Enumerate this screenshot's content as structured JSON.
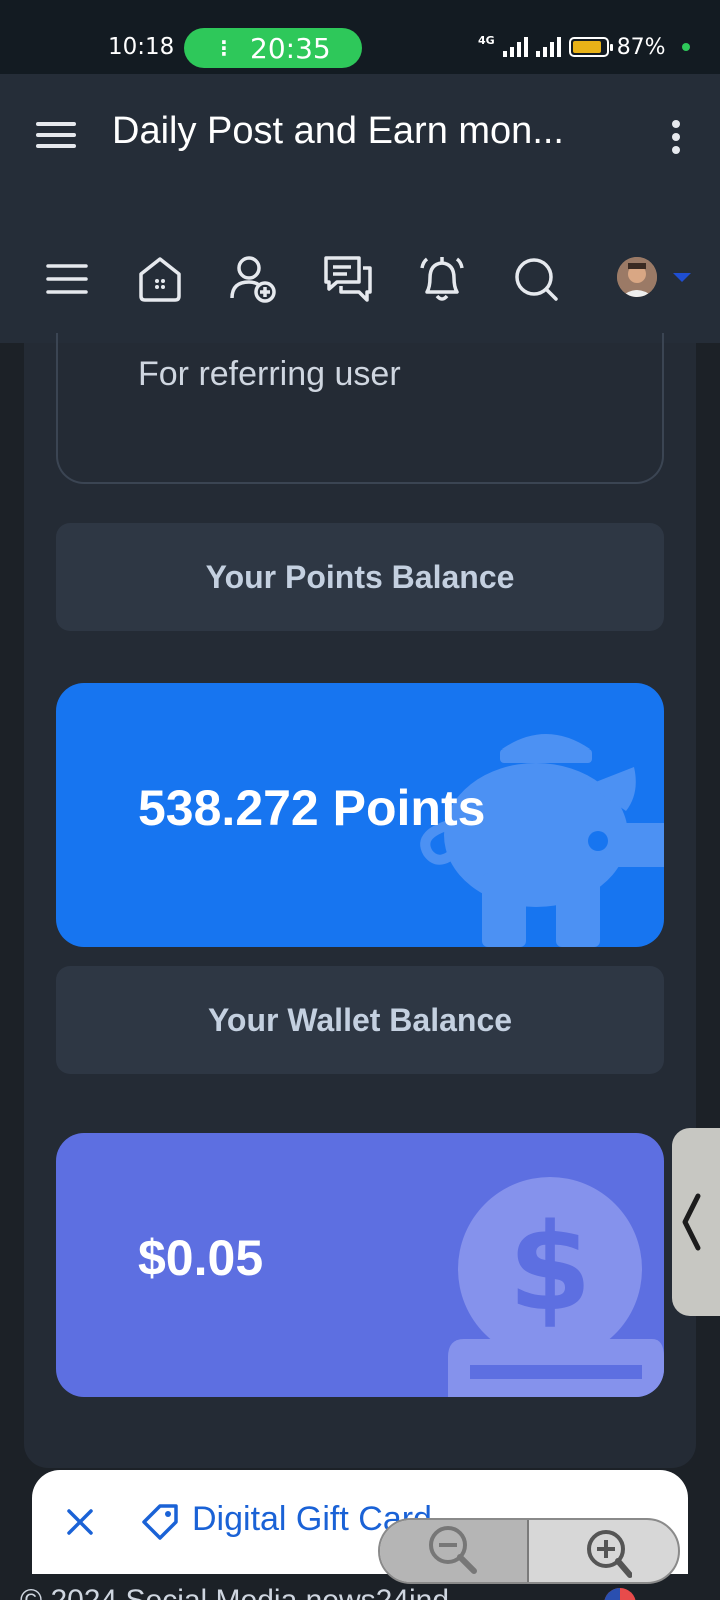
{
  "status_bar": {
    "time": "10:18",
    "call_timer": "20:35",
    "network": "4G",
    "battery_percent": "87%",
    "battery_level": 0.87,
    "colors": {
      "call_pill": "#2ec85a",
      "battery": "#e8b218"
    }
  },
  "app_bar": {
    "title": "Daily Post and Earn mon...",
    "menu_icon": "hamburger-icon",
    "overflow_icon": "kebab-icon"
  },
  "site_nav": {
    "icons": [
      "hamburger-icon",
      "home-icon",
      "add-user-icon",
      "messages-icon",
      "bell-icon",
      "search-icon",
      "avatar",
      "caret-down-icon"
    ]
  },
  "referral_card": {
    "text": "For referring user"
  },
  "points": {
    "heading": "Your Points Balance",
    "value": "538.272 Points",
    "icon": "piggy-bank-icon",
    "color": "#1775f0"
  },
  "wallet": {
    "heading": "Your Wallet Balance",
    "value": "$0.05",
    "icon": "dollar-coin-icon",
    "color": "#5d6fe1"
  },
  "ad_bar": {
    "text": "Digital Gift Card and V",
    "close_icon": "close-icon",
    "tag_icon": "tag-icon"
  },
  "zoom_controls": {
    "zoom_out_icon": "zoom-out-icon",
    "zoom_in_icon": "zoom-in-icon"
  },
  "footer": {
    "text": "© 2024 Social Media news24ind"
  }
}
